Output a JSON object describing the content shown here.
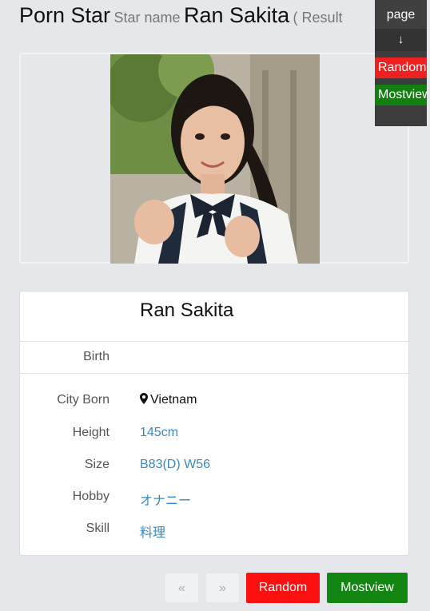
{
  "header": {
    "title": "Porn Star",
    "subtitle": "Star name",
    "star_name": "Ran Sakita",
    "result_fragment": "( Result"
  },
  "side_nav": {
    "page_label": "page",
    "down_arrow": "↓",
    "random_label": "Random",
    "mostview_label": "Mostview"
  },
  "profile": {
    "name": "Ran Sakita",
    "birth_label": "Birth",
    "birth_value": "",
    "fields": [
      {
        "label": "City Born",
        "value": "Vietnam",
        "icon": "map-marker-icon"
      },
      {
        "label": "Height",
        "value": "145cm"
      },
      {
        "label": "Size",
        "value": "B83(D) W56"
      },
      {
        "label": "Hobby",
        "value": "オナニー"
      },
      {
        "label": "Skill",
        "value": "料理"
      }
    ]
  },
  "pagination": {
    "prev": "«",
    "next": "»",
    "random": "Random",
    "mostview": "Mostview"
  },
  "colors": {
    "background": "#e6e7ea",
    "link": "#3a87c3",
    "random": "#ff1010",
    "mostview": "#138513"
  }
}
